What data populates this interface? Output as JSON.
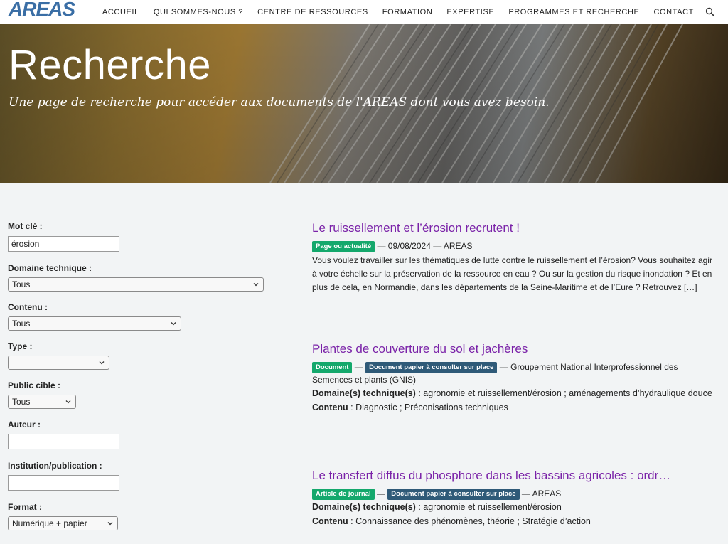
{
  "header": {
    "logo_text": "AREAS",
    "nav": [
      "ACCUEIL",
      "QUI SOMMES-NOUS ?",
      "CENTRE DE RESSOURCES",
      "FORMATION",
      "EXPERTISE",
      "PROGRAMMES ET RECHERCHE",
      "CONTACT"
    ],
    "search_icon": "search-icon"
  },
  "hero": {
    "title": "Recherche",
    "subtitle": "Une page de recherche pour accéder aux documents de l'AREAS dont vous avez besoin."
  },
  "filters": {
    "keyword_label": "Mot clé :",
    "keyword_value": "érosion",
    "domaine_label": "Domaine technique :",
    "domaine_value": "Tous",
    "contenu_label": "Contenu :",
    "contenu_value": "Tous",
    "type_label": "Type :",
    "type_value": "",
    "public_label": "Public cible :",
    "public_value": "Tous",
    "auteur_label": "Auteur :",
    "auteur_value": "",
    "institution_label": "Institution/publication :",
    "institution_value": "",
    "format_label": "Format :",
    "format_value": "Numérique + papier"
  },
  "results": [
    {
      "title": "Le ruissellement et l’érosion recrutent !",
      "badge1": "Page ou actualité",
      "meta_rest": " — 09/08/2024 — AREAS",
      "excerpt": "Vous voulez travailler sur les thématiques de lutte contre le ruissellement et l’érosion? Vous souhaitez agir à votre échelle sur la préservation de la ressource en eau ? Ou sur la gestion du risque inondation ? Et en plus de cela, en Normandie, dans les départements de la Seine-Maritime et de l’Eure ?   Retrouvez […]"
    },
    {
      "title": "Plantes de couverture du sol et jachères",
      "badge1": "Document",
      "badge2": "Document papier à consulter sur place",
      "meta_rest": " — Groupement National Interprofessionnel des Semences et plants (GNIS)",
      "domaine_label": "Domaine(s) technique(s)",
      "domaine_value": " : agronomie et ruissellement/érosion ; aménagements d’hydraulique douce",
      "contenu_label": "Contenu",
      "contenu_value": " : Diagnostic ; Préconisations techniques"
    },
    {
      "title": "Le transfert diffus du phosphore dans les bassins agricoles : ordr…",
      "badge1": "Article de journal",
      "badge2": "Document papier à consulter sur place",
      "meta_rest": " — AREAS",
      "domaine_label": "Domaine(s) technique(s)",
      "domaine_value": " : agronomie et ruissellement/érosion",
      "contenu_label": "Contenu",
      "contenu_value": " : Connaissance des phénomènes, théorie ; Stratégie d’action"
    }
  ],
  "colors": {
    "link_purple": "#7a22a8",
    "badge_green": "#14a86c",
    "badge_blue": "#2f5a78",
    "logo_blue": "#3a6ea5"
  }
}
